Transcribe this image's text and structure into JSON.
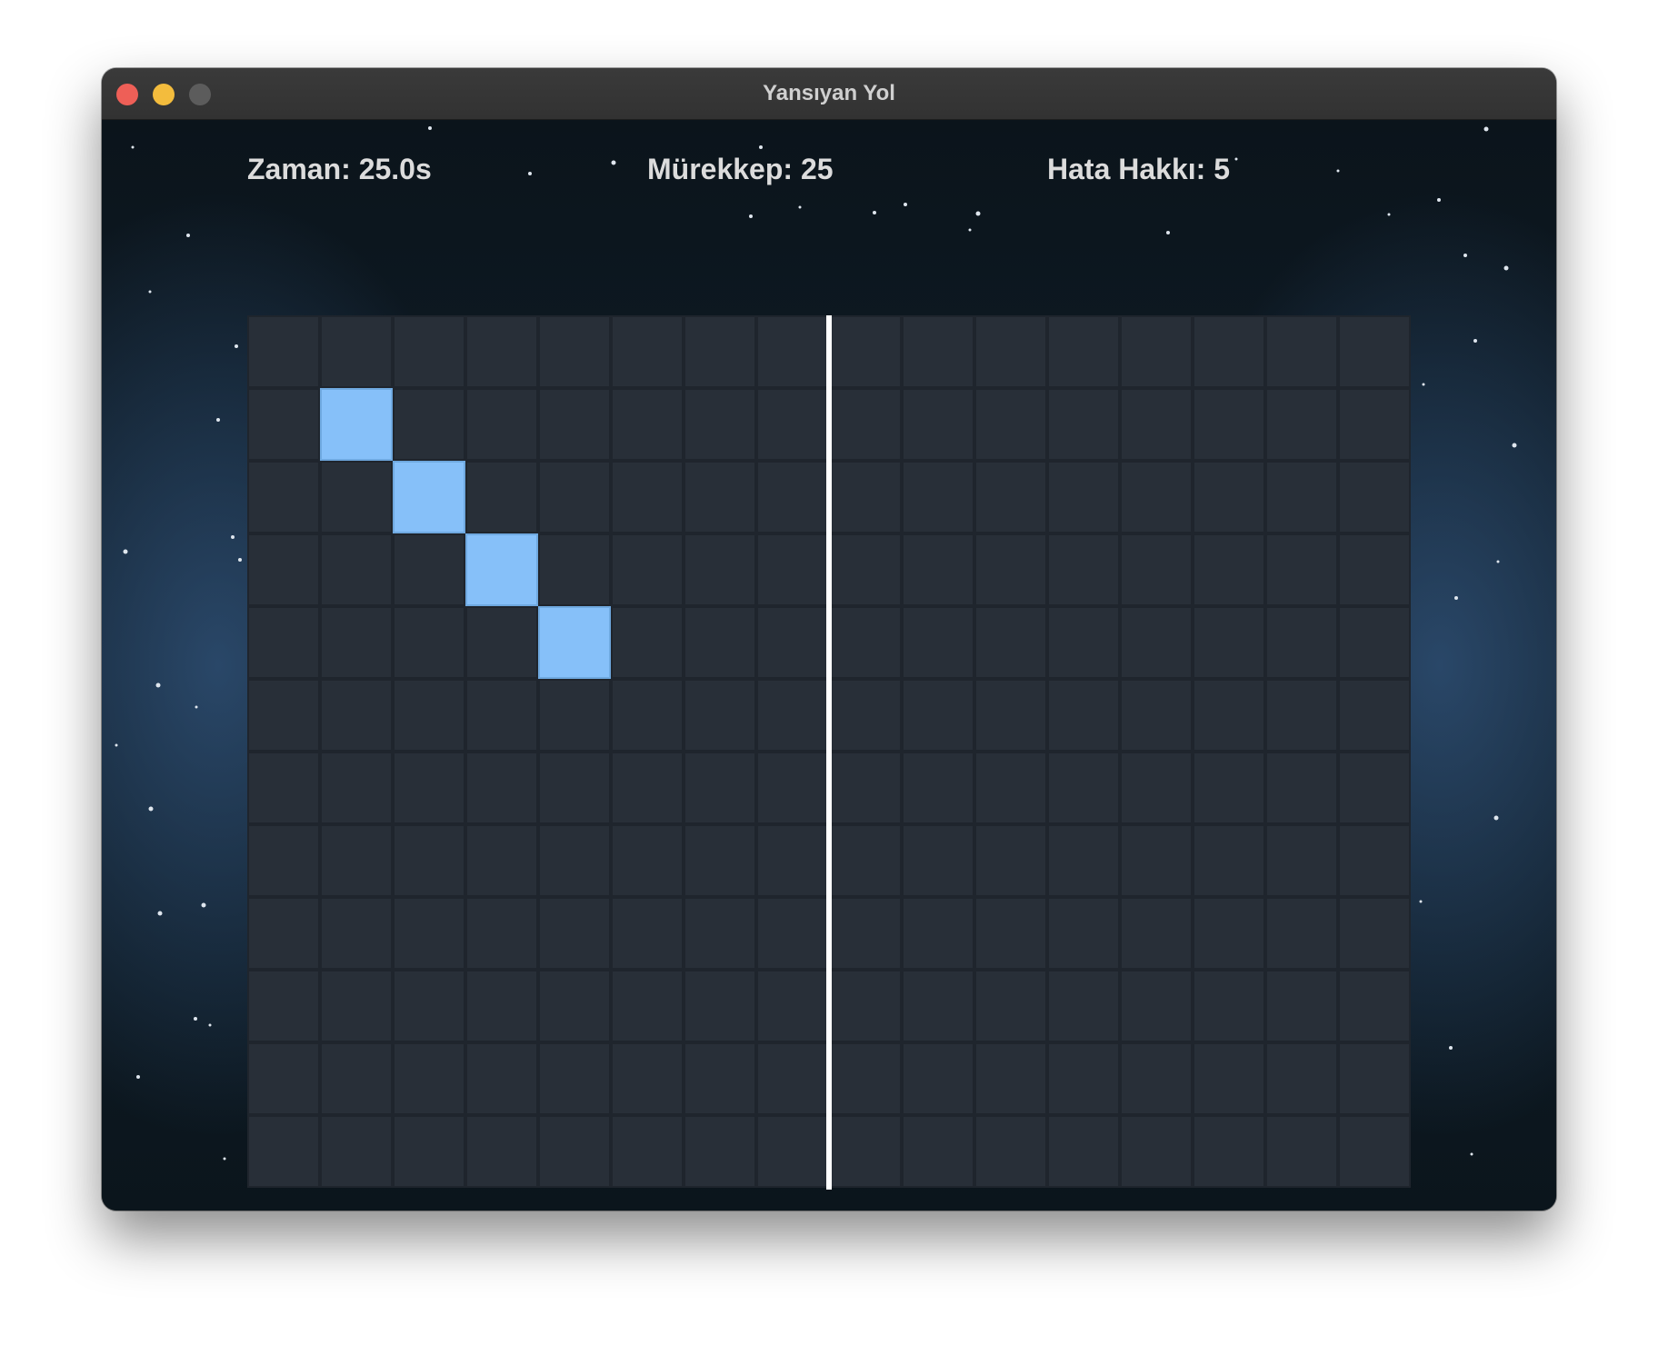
{
  "window": {
    "title": "Yansıyan Yol",
    "controls": [
      "close",
      "minimize",
      "maximize"
    ]
  },
  "hud": {
    "time": "Zaman: 25.0s",
    "ink": "Mürekkep: 25",
    "lives": "Hata Hakkı: 5"
  },
  "board": {
    "columns": 16,
    "rows": 12,
    "mirror_between_columns": [
      8,
      9
    ],
    "filled_cells": [
      {
        "row": 2,
        "col": 2
      },
      {
        "row": 3,
        "col": 3
      },
      {
        "row": 4,
        "col": 4
      },
      {
        "row": 5,
        "col": 5
      }
    ]
  },
  "colors": {
    "background": "#0c161d",
    "cell": "#282f38",
    "cell_border": "#1f252d",
    "filled_cell": "#86c0f9",
    "mirror_line": "#ffffff",
    "hud_text": "#dcdcdc"
  }
}
